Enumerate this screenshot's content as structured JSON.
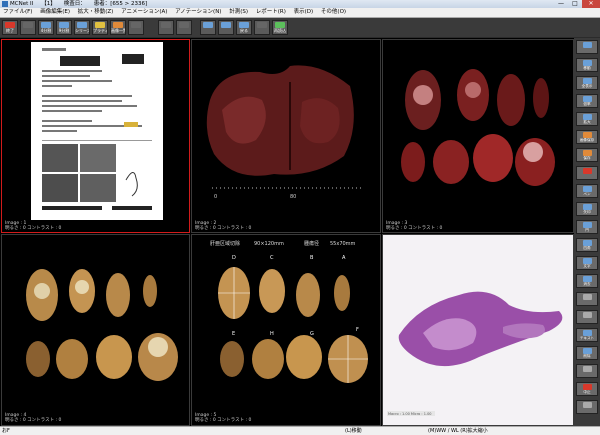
{
  "titlebar": {
    "app_name": "MCNet II",
    "field1": "【1】",
    "field2": "検査日：",
    "field3": "患者：[655 > 2336]",
    "min": "—",
    "max": "□",
    "close": "✕"
  },
  "menu": [
    "ファイル(F)",
    "画像編集(E)",
    "拡大・移動(Z)",
    "アニメーション(A)",
    "アノテーション(N)",
    "計測(S)",
    "レポート(R)",
    "表示(D)",
    "その他(O)"
  ],
  "toolbar": [
    {
      "label": "終了",
      "icon": "exit-icon",
      "color": "#d8382b"
    },
    {
      "label": "",
      "icon": "blank-icon",
      "color": "#666"
    },
    {
      "label": "4分割",
      "icon": "grid-icon",
      "color": "#6aa0d8"
    },
    {
      "label": "9分割",
      "icon": "grid9-icon",
      "color": "#6aa0d8"
    },
    {
      "label": "シリーズ",
      "icon": "series-icon",
      "color": "#6aa0d8"
    },
    {
      "label": "プラティブ",
      "icon": "pen-icon",
      "color": "#e0c040"
    },
    {
      "label": "画像一覧",
      "icon": "list-icon",
      "color": "#e08a3a"
    },
    {
      "label": "",
      "icon": "blank-icon",
      "color": "#666"
    },
    {
      "label": "",
      "icon": "blank-icon",
      "color": "#666"
    },
    {
      "label": "",
      "icon": "blank-icon",
      "color": "#666"
    },
    {
      "label": "",
      "icon": "left-arrow-icon",
      "color": "#6aa0d8"
    },
    {
      "label": "",
      "icon": "right-arrow-icon",
      "color": "#6aa0d8"
    },
    {
      "label": "戻る",
      "icon": "back-icon",
      "color": "#6aa0d8"
    },
    {
      "label": "",
      "icon": "blank-icon",
      "color": "#666"
    },
    {
      "label": "再読込",
      "icon": "reload-icon",
      "color": "#5cbf5c"
    }
  ],
  "panes": [
    {
      "image_label": "Image : 1",
      "info_label": "明るさ : 0  コントラスト : 0",
      "selected": true
    },
    {
      "image_label": "Image : 2",
      "info_label": "明るさ : 0  コントラスト : 0",
      "selected": false
    },
    {
      "image_label": "Image : 3",
      "info_label": "明るさ : 0  コントラスト : 0",
      "selected": false
    },
    {
      "image_label": "Image : 4",
      "info_label": "明るさ : 0  コントラスト : 0",
      "selected": false
    },
    {
      "image_label": "Image : 5",
      "info_label": "明るさ : 0  コントラスト : 0",
      "selected": false
    },
    {
      "image_label": "",
      "info_label": "",
      "selected": false
    }
  ],
  "overlay": {
    "pane5_title": "肝亜区域切除",
    "pane5_size1": "90×120mm",
    "pane5_tumor": "腫瘍径",
    "pane5_size2": "55x70mm",
    "letters": [
      "D",
      "C",
      "B",
      "A",
      "F",
      "G",
      "H",
      "E"
    ],
    "scale_top_left": "0",
    "scale_top_right": "80",
    "micro_caption": "Macro : 1.00  Micro : 1.00"
  },
  "sidebar": [
    {
      "label": "",
      "icon": "cursor-icon",
      "color": "#6aa0d8"
    },
    {
      "label": "移動",
      "icon": "move-icon",
      "color": "#6aa0d8"
    },
    {
      "label": "全表示",
      "icon": "fit-icon",
      "color": "#6aa0d8"
    },
    {
      "label": "倍率",
      "icon": "zoom-icon",
      "color": "#6aa0d8"
    },
    {
      "label": "拡大",
      "icon": "magnify-icon",
      "color": "#6aa0d8"
    },
    {
      "label": "画像保存",
      "icon": "save-icon",
      "color": "#e08a3a"
    },
    {
      "label": "保存",
      "icon": "disk-icon",
      "color": "#e08a3a"
    },
    {
      "label": "",
      "icon": "calc-icon",
      "color": "#d8382b"
    },
    {
      "label": "ペン",
      "icon": "pen-icon",
      "color": "#6aa0d8"
    },
    {
      "label": "矢印",
      "icon": "arrow-icon",
      "color": "#6aa0d8"
    },
    {
      "label": "円",
      "icon": "circle-icon",
      "color": "#6aa0d8"
    },
    {
      "label": "四角",
      "icon": "rect-icon",
      "color": "#6aa0d8"
    },
    {
      "label": "文字",
      "icon": "text-icon",
      "color": "#6aa0d8"
    },
    {
      "label": "消去",
      "icon": "eraser-icon",
      "color": "#6aa0d8"
    },
    {
      "label": "",
      "icon": "zoom-in-icon",
      "color": "#aaa"
    },
    {
      "label": "",
      "icon": "zoom-out-icon",
      "color": "#aaa"
    },
    {
      "label": "テキスト",
      "icon": "note-icon",
      "color": "#6aa0d8"
    },
    {
      "label": "削除",
      "icon": "delete-icon",
      "color": "#6aa0d8"
    },
    {
      "label": "",
      "icon": "blank-icon",
      "color": "#aaa"
    },
    {
      "label": "中止",
      "icon": "stop-icon",
      "color": "#d8382b"
    },
    {
      "label": "",
      "icon": "blank-icon",
      "color": "#aaa"
    }
  ],
  "statusbar": {
    "left": "おF",
    "middle": "(L)移動",
    "right": "(M)WW / WL (R)拡大縮小"
  }
}
